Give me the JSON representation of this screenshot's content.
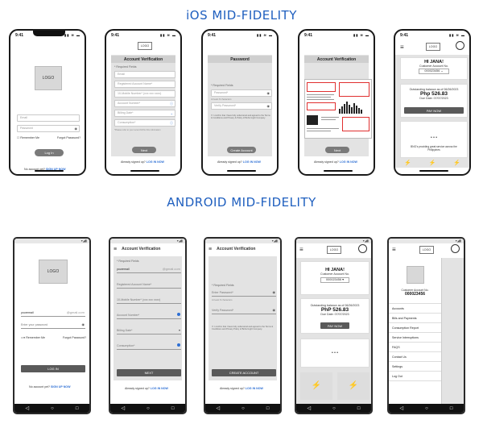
{
  "sections": {
    "ios_title": "iOS MID-FIDELITY",
    "android_title": "ANDROID MID-FIDELITY"
  },
  "ios": {
    "time": "9:41",
    "login": {
      "logo": "LOGO",
      "email_placeholder": "Email",
      "password_placeholder": "Password",
      "remember": "Remember Me",
      "forgot": "Forgot Password?",
      "login_button": "Log In",
      "no_account": "No account yet?",
      "signup": "SIGN UP NOW"
    },
    "verify": {
      "logo": "LOGO",
      "title": "Account Verification",
      "required": "* Required Fields",
      "fields": [
        "Email",
        "Registered Account Name*",
        "10-Mobile Number* (xxx xxx xxxx)",
        "Account Number*",
        "Billing Date*",
        "Consumption*"
      ],
      "note": "*Please refer to your recent bill for this information",
      "next": "Next",
      "signed_up": "Already signed up?",
      "login_now": "LOG IN NOW"
    },
    "password": {
      "title": "Password",
      "required": "* Required Fields",
      "password": "Password*",
      "verify": "Verify Password*",
      "hint": "At least 8 characters",
      "terms": "I confirm that I have fully understood and agreed to the Terms & Conditions and Privacy & Policy of Bohol Light Company",
      "create": "Create Account",
      "signed_up": "Already signed up?",
      "login_now": "LOG IN NOW"
    },
    "bill": {
      "title": "Account Verification",
      "next": "Next",
      "signed_up": "Already signed up?",
      "login_now": "LOG IN NOW"
    },
    "home": {
      "logo": "LOGO",
      "greeting": "HI JANA!",
      "customer_label": "Customer Account No.",
      "account": "000023456",
      "outstanding": "Outstanding balance as of 06/26/2023",
      "amount": "Php 526.83",
      "due": "Due Date: 07/07/2023",
      "pay_now": "PAY NOW",
      "dots": "• • •",
      "tagline": "BNG's providing great service across the Philippines"
    }
  },
  "android": {
    "login": {
      "logo": "LOGO",
      "email_value": "youremail",
      "email_suffix": "@gmail.com",
      "password_placeholder": "Enter your password",
      "remember": "Remember Me",
      "forgot": "Forgot Password?",
      "login_button": "LOG IN",
      "no_account": "No account yet?",
      "signup": "SIGN UP NOW"
    },
    "verify": {
      "title": "Account Verification",
      "required": "* Required Fields",
      "email_value": "youremail",
      "email_suffix": "@gmail.com",
      "fields": [
        "Registered Account Name*",
        "10-Mobile Number* (xxx xxx xxxx)",
        "Account Number*",
        "Billing Date*",
        "Consumption*"
      ],
      "next": "NEXT",
      "signed_up": "Already signed up?",
      "login_now": "LOG IN NOW"
    },
    "password": {
      "title": "Account Verification",
      "required": "* Required Fields",
      "password": "Enter Password*",
      "hint": "At least 8 characters",
      "verify": "Verify Password*",
      "terms": "I confirm that I have fully understood and agreed to the Terms & Conditions and Privacy Policy of Bohol Light Company",
      "create": "CREATE ACCOUNT",
      "signed_up": "Already signed up?",
      "login_now": "LOG IN NOW"
    },
    "home": {
      "logo": "LOGO",
      "greeting": "HI JANA!",
      "customer_label": "Customer Account No.",
      "account": "000023456",
      "outstanding": "Outstanding balance as of 06/26/2023",
      "amount": "PhP 526.83",
      "due": "Due Date: 07/07/2023",
      "pay_now": "PAY NOW",
      "dots": "• • •"
    },
    "menu": {
      "logo": "LOGO",
      "customer_label": "Customer Account No.",
      "account": "000023456",
      "items": [
        "Accounts",
        "Bills and Payments",
        "Consumption Report",
        "Service Interruptions",
        "FAQS",
        "Contact Us",
        "Settings",
        "Log Out"
      ]
    }
  }
}
